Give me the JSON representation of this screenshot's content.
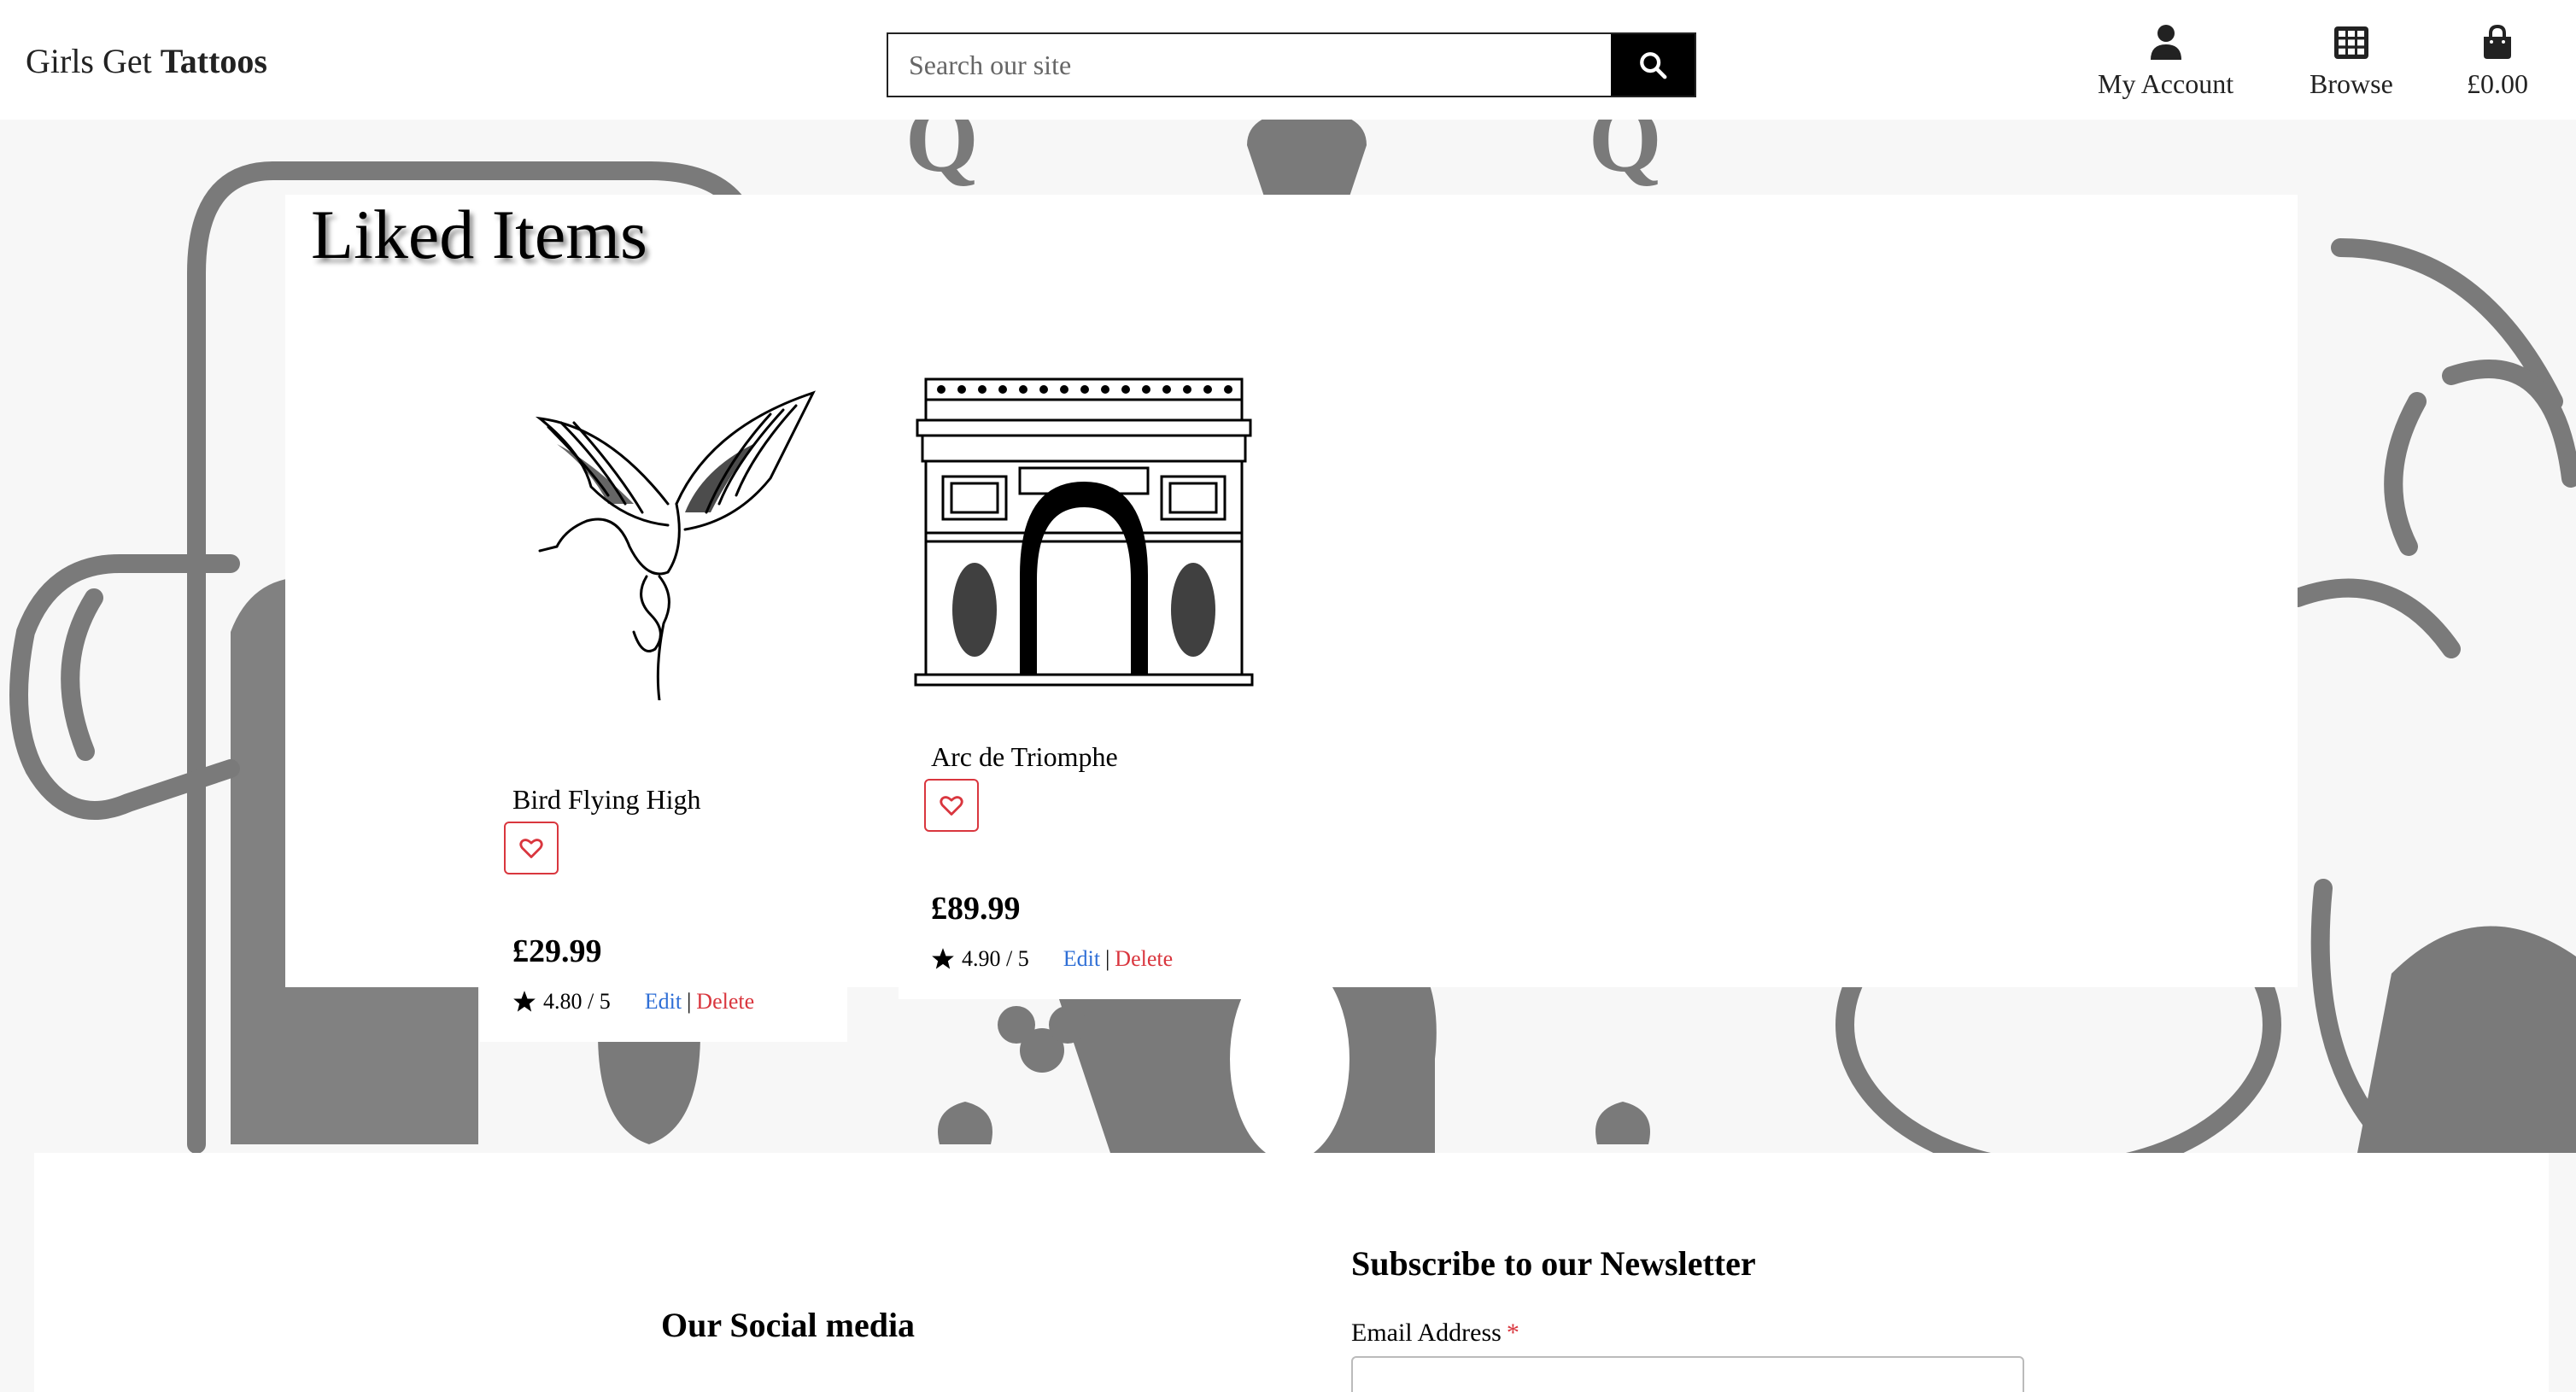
{
  "header": {
    "brand_regular": "Girls Get ",
    "brand_bold": "Tattoos",
    "search_placeholder": "Search our site",
    "nav": {
      "account_label": "My Account",
      "browse_label": "Browse",
      "cart_label": "£0.00"
    }
  },
  "main": {
    "title": "Liked Items",
    "products": [
      {
        "name": "Bird Flying High",
        "price": "£29.99",
        "rating": "4.80 / 5",
        "edit_label": "Edit",
        "separator": "|",
        "delete_label": "Delete",
        "image_icon": "flying-crane-illustration"
      },
      {
        "name": "Arc de Triomphe",
        "price": "£89.99",
        "rating": "4.90 / 5",
        "edit_label": "Edit",
        "separator": "|",
        "delete_label": "Delete",
        "image_icon": "arc-de-triomphe-illustration"
      }
    ]
  },
  "footer": {
    "social_title": "Our Social media",
    "newsletter_title": "Subscribe to our Newsletter",
    "email_label": "Email Address",
    "required_mark": "*"
  },
  "colors": {
    "accent_red": "#d9363e",
    "link_blue": "#2f6fd6",
    "background_art": "#7a7a7a"
  }
}
